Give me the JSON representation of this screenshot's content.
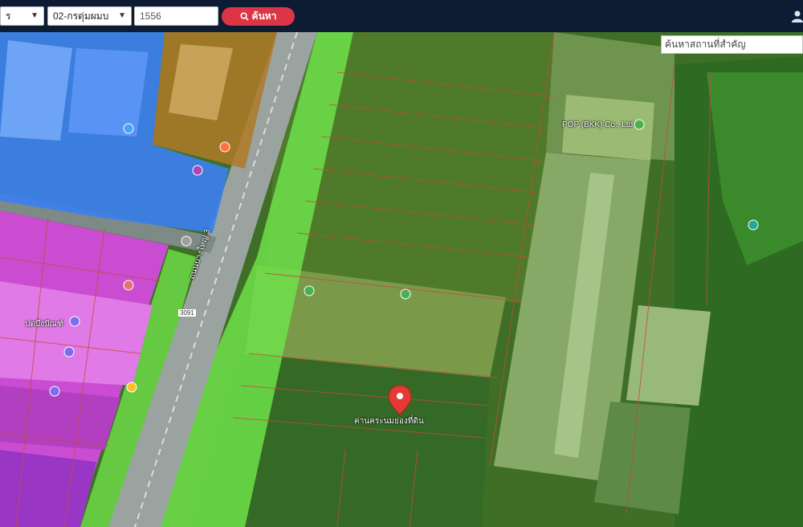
{
  "toolbar": {
    "province_select": "ร",
    "district_select": "02-กรตุ่มผมบ",
    "parcel_input": "1556",
    "search_button": "ค้นหา"
  },
  "map": {
    "place_search_placeholder": "ค้นหาสถานที่สำคัญ",
    "pin_label": "ค่านคระนมย่องที่ดิน",
    "road_label": "ถนนบางใหญ่ 3",
    "road_number": "3091",
    "poi_labels": [
      "POP (BKK) Co., Ltd",
      "ปดบึงปัณฑ์"
    ],
    "zone_colors": {
      "residential_blue": "#3b7ff2",
      "commercial_magenta": "#d64ae0",
      "commercial_orange": "#b07a28",
      "green_zone": "#6fe04a",
      "agricultural": "#3a7d2a"
    }
  }
}
